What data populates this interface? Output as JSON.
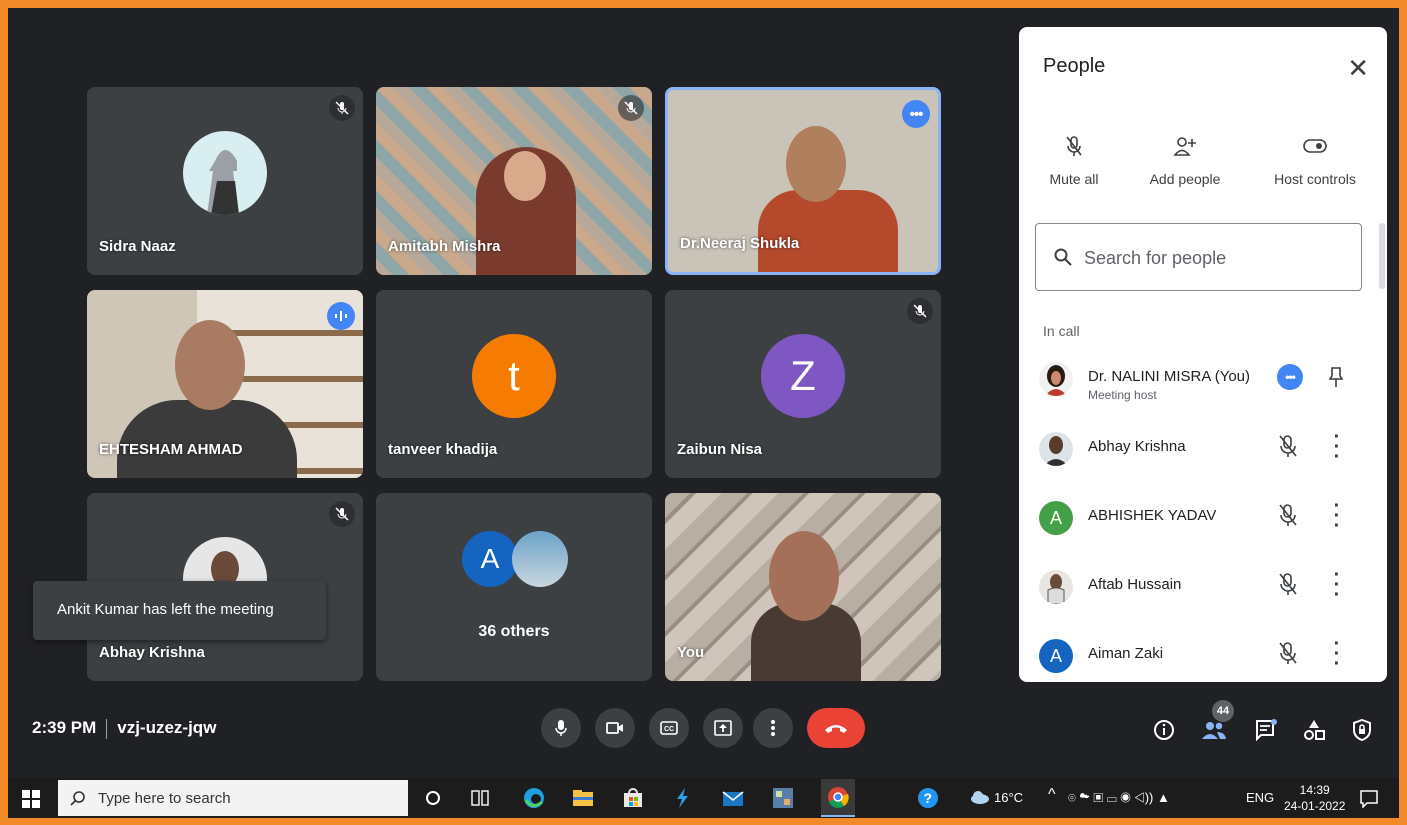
{
  "tiles": [
    {
      "name": "Sidra Naaz",
      "muted": true
    },
    {
      "name": "Amitabh Mishra",
      "muted": true
    },
    {
      "name": "Dr.Neeraj Shukla",
      "more": true
    },
    {
      "name": "EHTESHAM AHMAD",
      "speaking": true
    },
    {
      "name": "tanveer khadija",
      "initial": "t",
      "color": "#f57c00"
    },
    {
      "name": "Zaibun Nisa",
      "initial": "Z",
      "color": "#7e57c2",
      "muted": true
    },
    {
      "name": "Abhay Krishna",
      "muted": true
    },
    {
      "name": "36 others",
      "initial": "A",
      "color": "#1565c0"
    },
    {
      "name": "You"
    }
  ],
  "toast": "Ankit Kumar has left the meeting",
  "meeting": {
    "time": "2:39 PM",
    "code": "vzj-uzez-jqw"
  },
  "controls": [
    "mic-icon",
    "camera-icon",
    "captions-icon",
    "present-icon",
    "more-options-icon",
    "end-call-icon"
  ],
  "right_icons": [
    "info-icon",
    "people-icon",
    "chat-icon",
    "activities-icon",
    "lock-icon"
  ],
  "participant_count": "44",
  "panel": {
    "title": "People",
    "actions": [
      "Mute all",
      "Add people",
      "Host controls"
    ],
    "search_placeholder": "Search for people",
    "section": "In call",
    "people": [
      {
        "name": "Dr. NALINI MISRA (You)",
        "sub": "Meeting host"
      },
      {
        "name": "Abhay Krishna"
      },
      {
        "name": "ABHISHEK YADAV",
        "initial": "A",
        "color": "#43a047"
      },
      {
        "name": "Aftab Hussain"
      },
      {
        "name": "Aiman Zaki",
        "initial": "A",
        "color": "#1565c0"
      }
    ]
  },
  "taskbar": {
    "search_placeholder": "Type here to search",
    "weather": "16°C",
    "lang": "ENG",
    "time": "14:39",
    "date": "24-01-2022"
  }
}
